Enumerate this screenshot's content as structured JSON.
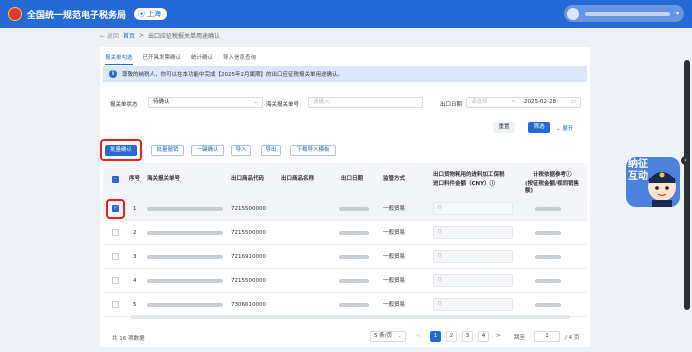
{
  "header": {
    "app_title": "全国统一规范电子税务局",
    "region": "上海"
  },
  "breadcrumb": {
    "back": "← 返回",
    "home": "首页",
    "sep": ">",
    "current": "出口应征税报关单用途确认"
  },
  "tabs": [
    {
      "label": "报关单勾选",
      "active": true
    },
    {
      "label": "已开具发票确认",
      "active": false
    },
    {
      "label": "统计确认",
      "active": false
    },
    {
      "label": "导入信息查询",
      "active": false
    }
  ],
  "notice": "尊敬的纳税人，你可以在本功能中完成【2025年2月属期】的出口应征税报关单用途确认。",
  "filters": {
    "status_label": "报关单状态",
    "status_value": "待确认",
    "declno_label": "海关报关单号",
    "declno_placeholder": "请输入",
    "date_label": "出口日期",
    "date_start_placeholder": "请选择",
    "date_sep": "~",
    "date_end": "2025-02-28",
    "reset": "重置",
    "search": "筛选",
    "expand": "展开"
  },
  "actions": [
    "批量确认",
    "批量撤销",
    "一键确认",
    "导入",
    "导出",
    "下载导入模板"
  ],
  "table": {
    "headers": {
      "seq": "序号",
      "declno": "海关报关单号",
      "code": "出口商品代码",
      "name": "出口商品名称",
      "date": "出口日期",
      "trade": "监管方式",
      "amount_l1": "出口货物耗用的进料加工保税",
      "amount_l2": "进口料件金额（CNY）ⓘ",
      "calc_l1": "计税依据参考ⓘ",
      "calc_l2": "(按征税金额/视同销售额)"
    },
    "rows": [
      {
        "seq": "1",
        "code": "7215500000",
        "trade": "一般贸易",
        "amount": "0",
        "checked": true
      },
      {
        "seq": "2",
        "code": "7215500000",
        "trade": "一般贸易",
        "amount": "0",
        "checked": false
      },
      {
        "seq": "3",
        "code": "7216910000",
        "trade": "一般贸易",
        "amount": "0",
        "checked": false
      },
      {
        "seq": "4",
        "code": "7215500000",
        "trade": "一般贸易",
        "amount": "0",
        "checked": false
      },
      {
        "seq": "5",
        "code": "7306610000",
        "trade": "一般贸易",
        "amount": "0",
        "checked": false
      }
    ]
  },
  "pagination": {
    "total": "共 16 项数据",
    "page_size": "5 条/页",
    "pages": [
      "1",
      "2",
      "3",
      "4"
    ],
    "jump_label": "跳至",
    "jump_value": "1",
    "page_total": "/ 4 页",
    "prev": "<",
    "next": ">"
  },
  "mascot": {
    "text": "纳征互动"
  },
  "colors": {
    "primary": "#2469d4",
    "highlight": "#e8221b",
    "notice_bg": "#dbe8fc"
  }
}
